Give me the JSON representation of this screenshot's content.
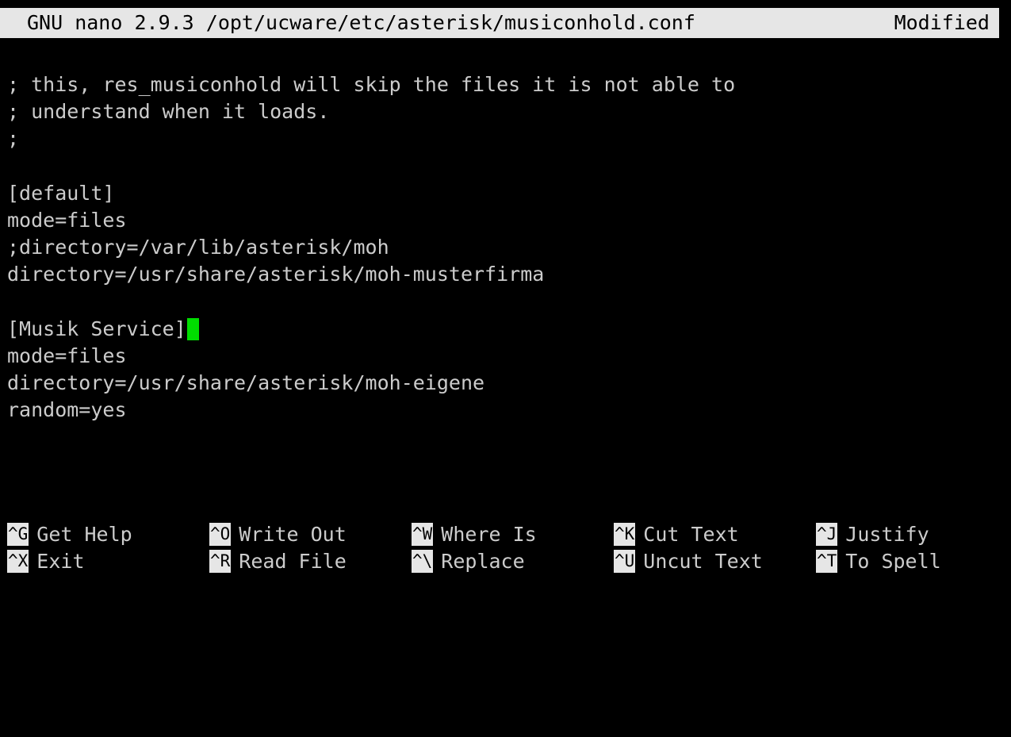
{
  "colors": {
    "background": "#000000",
    "text": "#cccccc",
    "title_bar_bg": "#e6e6e6",
    "title_bar_text": "#000000",
    "cursor": "#00dd00"
  },
  "title_bar": {
    "app": "GNU nano 2.9.3 /opt/ucware/etc/asterisk/musiconhold.conf",
    "status": "Modified"
  },
  "editor": {
    "lines": [
      "; this, res_musiconhold will skip the files it is not able to",
      "; understand when it loads.",
      ";",
      "",
      "[default]",
      "mode=files",
      ";directory=/var/lib/asterisk/moh",
      "directory=/usr/share/asterisk/moh-musterfirma",
      "",
      "[Musik Service]",
      "mode=files",
      "directory=/usr/share/asterisk/moh-eigene",
      "random=yes"
    ],
    "cursor_line": 9
  },
  "shortcuts": {
    "row1": [
      {
        "key": "^G",
        "label": "Get Help"
      },
      {
        "key": "^O",
        "label": "Write Out"
      },
      {
        "key": "^W",
        "label": "Where Is"
      },
      {
        "key": "^K",
        "label": "Cut Text"
      },
      {
        "key": "^J",
        "label": "Justify"
      }
    ],
    "row2": [
      {
        "key": "^X",
        "label": "Exit"
      },
      {
        "key": "^R",
        "label": "Read File"
      },
      {
        "key": "^\\",
        "label": "Replace"
      },
      {
        "key": "^U",
        "label": "Uncut Text"
      },
      {
        "key": "^T",
        "label": "To Spell"
      }
    ]
  }
}
